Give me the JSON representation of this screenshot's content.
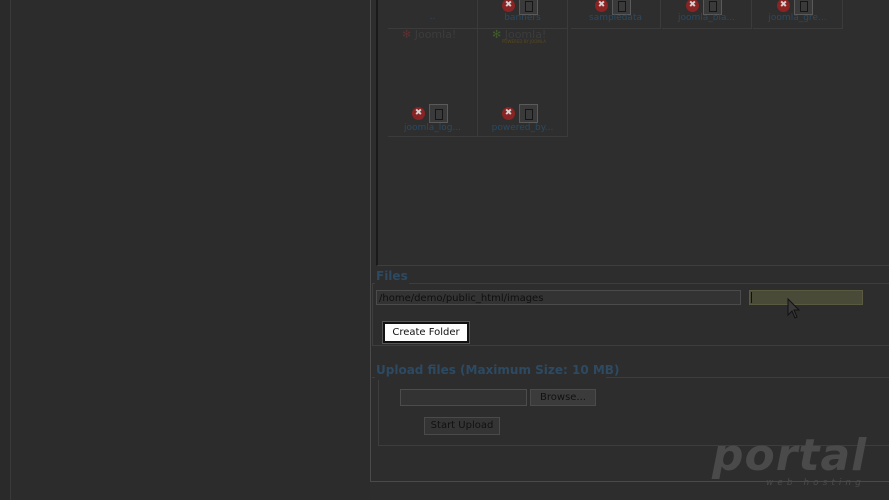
{
  "browser": {
    "top_row": [
      {
        "name": "..",
        "has_tools": false
      },
      {
        "name": "banners",
        "has_tools": true
      },
      {
        "name": "sampledata",
        "has_tools": true
      },
      {
        "name": "joomla_bla...",
        "has_tools": true
      },
      {
        "name": "joomla_gre...",
        "has_tools": true
      }
    ],
    "second_row": [
      {
        "name": "joomla_log...",
        "logo_text": "Joomla!"
      },
      {
        "name": "powered_by...",
        "logo_text": "Joomla!",
        "logo_sub": "POWERED BY JOOMLA"
      }
    ],
    "delete_glyph": "✖"
  },
  "files": {
    "legend": "Files",
    "path_value": "/home/demo/public_html/images",
    "folder_name_value": "",
    "create_folder_label": "Create Folder"
  },
  "upload": {
    "legend": "Upload files (Maximum Size: 10 MB)",
    "browse_label": "Browse...",
    "start_label": "Start Upload"
  },
  "watermark": {
    "text": "portal",
    "sub": "web hosting"
  },
  "colors": {
    "accent": "#2d4a62",
    "link": "#294a63",
    "overlay": "#2d2d2d"
  }
}
